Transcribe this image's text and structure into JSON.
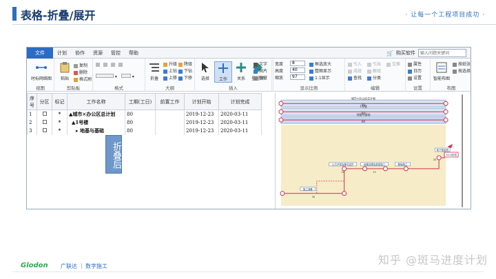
{
  "slide": {
    "title": "表格-折叠/展开",
    "tagline": "· 让每一个工程项目成功 ·",
    "logo": "Glodon",
    "logo_cn": "广联达",
    "separator": "|",
    "product": "数字施工",
    "watermark": "知乎 @斑马进度计划"
  },
  "app": {
    "menu": [
      "文件",
      "计划",
      "协作",
      "资源",
      "管控",
      "帮助"
    ],
    "buy_label": "购买软件",
    "search_placeholder": "输入问题关键词"
  },
  "ribbon": {
    "groups": [
      "视图",
      "剪贴板",
      "格式",
      "大纲",
      "插入",
      "显示比例",
      "编辑",
      "设置",
      "布图"
    ],
    "view": {
      "timescale": "时标网络图"
    },
    "clipboard": {
      "paste": "粘贴",
      "copy": "复制",
      "delete": "删除",
      "format_painter": "格式刷"
    },
    "outline": {
      "fold": "折叠",
      "upgrade": "升级",
      "downgrade": "降级",
      "drill_up": "上钻",
      "drill_down": "下钻",
      "move_up": "上移",
      "move_down": "下移"
    },
    "insert": {
      "select": "选择",
      "work": "工作",
      "relation": "关系",
      "milestone": "里程碑",
      "text": "文字",
      "image": "图片",
      "space": "空窗"
    },
    "zoom": {
      "width_label": "宽度",
      "width_val": "8",
      "height_label": "高度",
      "height_val": "40",
      "scale_label": "缩放",
      "scale_val": "97",
      "box_zoom": "框选放大",
      "fit": "整图显示",
      "one_to_one": "1:1显示"
    },
    "edit": {
      "import": "引入",
      "group": "成组",
      "find": "查找",
      "cite": "引出",
      "ungroup": "解组",
      "classify": "分类",
      "swap": "交换"
    },
    "settings": {
      "property": "属性",
      "calendar": "日历",
      "setup": "设置"
    },
    "layout": {
      "smart": "智能布图",
      "by_paper": "按纸张",
      "by_select": "按选择"
    }
  },
  "table": {
    "headers": [
      "序号",
      "分区",
      "标记",
      "工作名称",
      "工期(工日)",
      "前置工作",
      "计划开始",
      "计划完成"
    ],
    "rows": [
      {
        "no": "1",
        "mark": "*",
        "name": "▲城市×办公区总计划",
        "dur": "80",
        "pred": "",
        "start": "2019-12-23",
        "end": "2020-03-11"
      },
      {
        "no": "2",
        "mark": "*",
        "name": "▲1号楼",
        "dur": "80",
        "pred": "",
        "start": "2019-12-23",
        "end": "2020-03-11"
      },
      {
        "no": "3",
        "mark": "*",
        "name": "▸ 地基与基础",
        "dur": "80",
        "pred": "",
        "start": "2019-12-23",
        "end": "2020-03-11"
      }
    ]
  },
  "overlay": {
    "text": "折叠后"
  },
  "gantt": {
    "bar1_label": "城市×办公区总计划",
    "bar1_dur": "80",
    "bar2_label": "1号楼",
    "bar2_dur": "80",
    "bar3_label": "地基与基础",
    "bar3_dur": "80",
    "tasks": [
      {
        "label": "施工准备",
        "dur": "30"
      },
      {
        "label": "土方开挖及基坑支护",
        "dur": "20"
      },
      {
        "label": "地基处理及垫层施工",
        "dur": "15"
      },
      {
        "label": "基础施工",
        "dur": ""
      },
      {
        "label": "地下室结构",
        "dur": "20"
      },
      {
        "label": "±0.0封顶",
        "dur": ""
      },
      {
        "label": "",
        "dur": "15"
      }
    ]
  },
  "colors": {
    "accent": "#2b6cc4",
    "bar_blue": "#c9d8f1",
    "bar_red": "#d32f4a",
    "gantt_bg": "#f6ecc8"
  }
}
